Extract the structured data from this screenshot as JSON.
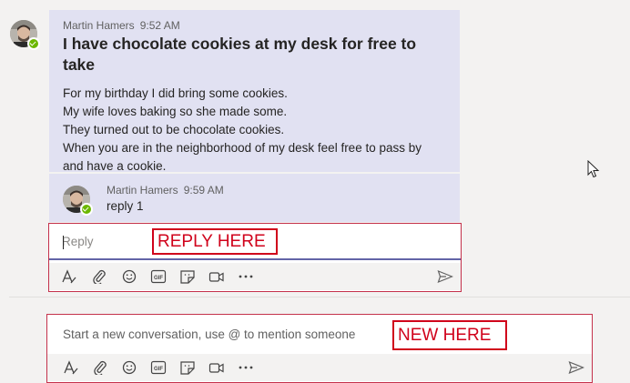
{
  "post": {
    "author": "Martin Hamers",
    "time": "9:52 AM",
    "title": "I have chocolate cookies at my desk for free to take",
    "body_lines": [
      "For my birthday I did bring some cookies.",
      "My wife loves baking so she made some.",
      "They turned out to be chocolate cookies.",
      "When you are in the neighborhood of my desk feel free to pass by",
      "and have a cookie."
    ]
  },
  "reply": {
    "author": "Martin Hamers",
    "time": "9:59 AM",
    "text": "reply 1"
  },
  "reply_box": {
    "placeholder": "Reply",
    "annotation": "REPLY HERE"
  },
  "new_box": {
    "placeholder": "Start a new conversation, use @ to mention someone",
    "annotation": "NEW HERE"
  },
  "toolbar_icons": [
    "format-icon",
    "attach-icon",
    "emoji-icon",
    "gif-icon",
    "sticker-icon",
    "meet-now-icon",
    "more-options-icon"
  ],
  "colors": {
    "accent": "#6264a7",
    "presence": "#6bb700",
    "annotation": "#d0021b",
    "thread_bg": "#e1e1f2"
  }
}
